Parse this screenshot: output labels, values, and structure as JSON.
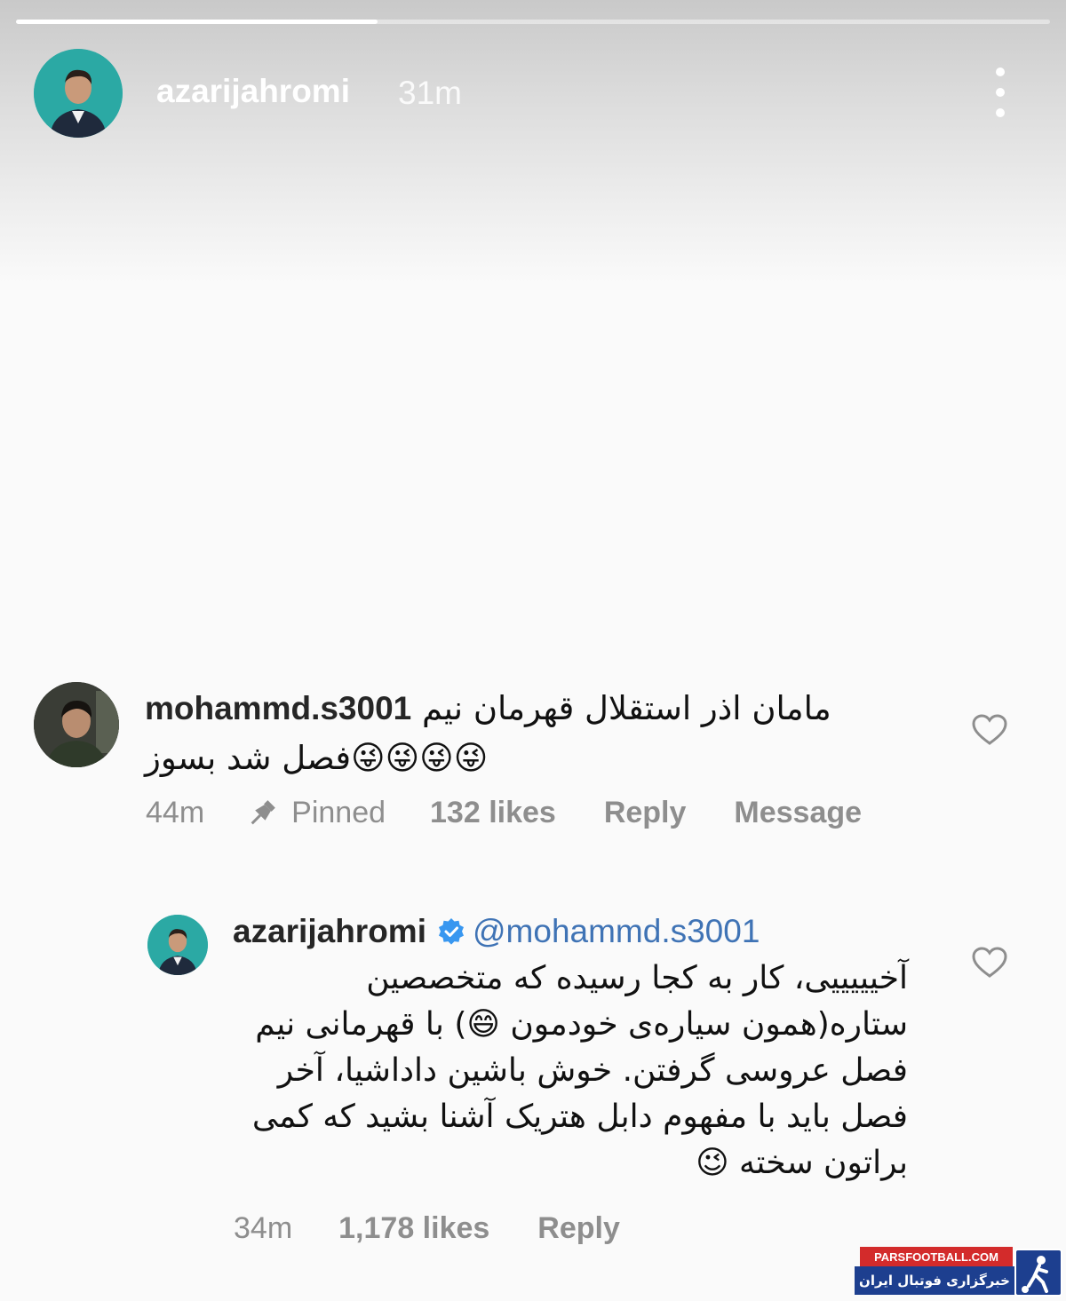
{
  "story": {
    "username": "azarijahromi",
    "time": "31m",
    "progress": 0.35
  },
  "comment": {
    "username": "mohammd.s3001",
    "text": "مامان اذر استقلال قهرمان نیم فصل شد بسوز😜😜😜😜",
    "time": "44m",
    "pinned_label": "Pinned",
    "likes": "132 likes",
    "reply_label": "Reply",
    "message_label": "Message"
  },
  "reply": {
    "username": "azarijahromi",
    "mention": "@mohammd.s3001",
    "text": "آخیییییی، کار به کجا رسیده که متخصصین ستاره(همون سیاره‌ی خودمون 😄) با قهرمانی نیم فصل عروسی گرفتن. خوش باشین داداشیا، آخر فصل باید با مفهوم دابل هتریک آشنا بشید که کمی براتون سخته 😉",
    "time": "34m",
    "likes": "1,178 likes",
    "reply_label": "Reply"
  },
  "watermark": {
    "site": "PARSFOOTBALL.COM",
    "tagline": "خبرگزاری فوتبال ایران"
  },
  "icons": {
    "more": "more-vertical-icon",
    "pin": "pin-icon",
    "heart": "heart-outline-icon",
    "verified": "verified-badge-icon"
  },
  "colors": {
    "mention": "#3f73b5",
    "meta": "#8e8e8e",
    "verified": "#3897f0",
    "avatar_bg": "#2ba9a4"
  }
}
